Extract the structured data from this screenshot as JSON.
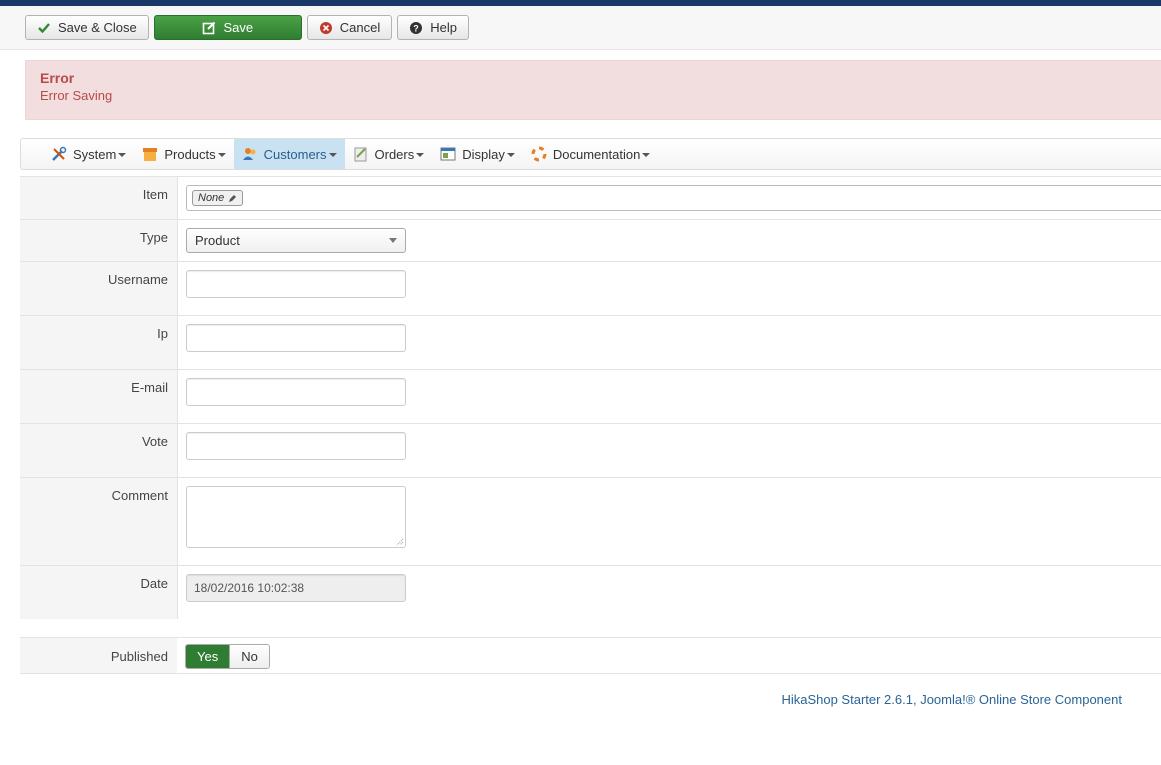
{
  "toolbar": {
    "save_close": "Save & Close",
    "save": "Save",
    "cancel": "Cancel",
    "help": "Help"
  },
  "alert": {
    "title": "Error",
    "message": "Error Saving"
  },
  "menu": [
    {
      "label": "System",
      "icon": "tools-icon"
    },
    {
      "label": "Products",
      "icon": "box-icon"
    },
    {
      "label": "Customers",
      "icon": "users-icon"
    },
    {
      "label": "Orders",
      "icon": "orders-icon"
    },
    {
      "label": "Display",
      "icon": "display-icon"
    },
    {
      "label": "Documentation",
      "icon": "lifebuoy-icon"
    }
  ],
  "form": {
    "item_label": "Item",
    "item_value": "None",
    "type_label": "Type",
    "type_value": "Product",
    "username_label": "Username",
    "ip_label": "Ip",
    "email_label": "E-mail",
    "vote_label": "Vote",
    "comment_label": "Comment",
    "date_label": "Date",
    "date_value": "18/02/2016 10:02:38",
    "published_label": "Published",
    "published_yes": "Yes",
    "published_no": "No"
  },
  "footer": "HikaShop Starter 2.6.1, Joomla!® Online Store Component",
  "colors": {
    "accent_green": "#2f7d32",
    "error_bg": "#f2dede",
    "error_text": "#b94a48",
    "link": "#2a6496"
  }
}
